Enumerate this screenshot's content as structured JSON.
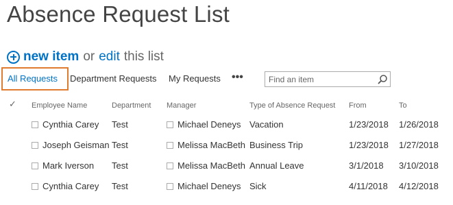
{
  "page": {
    "title": "Absence Request List"
  },
  "actions": {
    "new_item_label": "new item",
    "or_text": "or",
    "edit_label": "edit",
    "this_list_text": "this list"
  },
  "views": {
    "tabs": [
      {
        "label": "All Requests",
        "selected": true
      },
      {
        "label": "Department Requests",
        "selected": false
      },
      {
        "label": "My Requests",
        "selected": false
      }
    ],
    "more_label": "•••"
  },
  "search": {
    "placeholder": "Find an item",
    "icon": "search-icon"
  },
  "table": {
    "columns": [
      "Employee Name",
      "Department",
      "Manager",
      "Type of Absence Request",
      "From",
      "To"
    ],
    "rows": [
      {
        "employee": "Cynthia Carey",
        "department": "Test",
        "manager": "Michael Deneys",
        "type": "Vacation",
        "from": "1/23/2018",
        "to": "1/26/2018"
      },
      {
        "employee": "Joseph Geisman",
        "department": "Test",
        "manager": "Melissa MacBeth",
        "type": "Business Trip",
        "from": "1/23/2018",
        "to": "1/27/2018"
      },
      {
        "employee": "Mark Iverson",
        "department": "Test",
        "manager": "Melissa MacBeth",
        "type": "Annual Leave",
        "from": "3/1/2018",
        "to": "3/10/2018"
      },
      {
        "employee": "Cynthia Carey",
        "department": "Test",
        "manager": "Michael Deneys",
        "type": "Sick",
        "from": "4/11/2018",
        "to": "4/12/2018"
      }
    ]
  },
  "colors": {
    "accent": "#0072c6",
    "selected_border": "#e07a2e",
    "text": "#333333",
    "muted": "#666666"
  }
}
